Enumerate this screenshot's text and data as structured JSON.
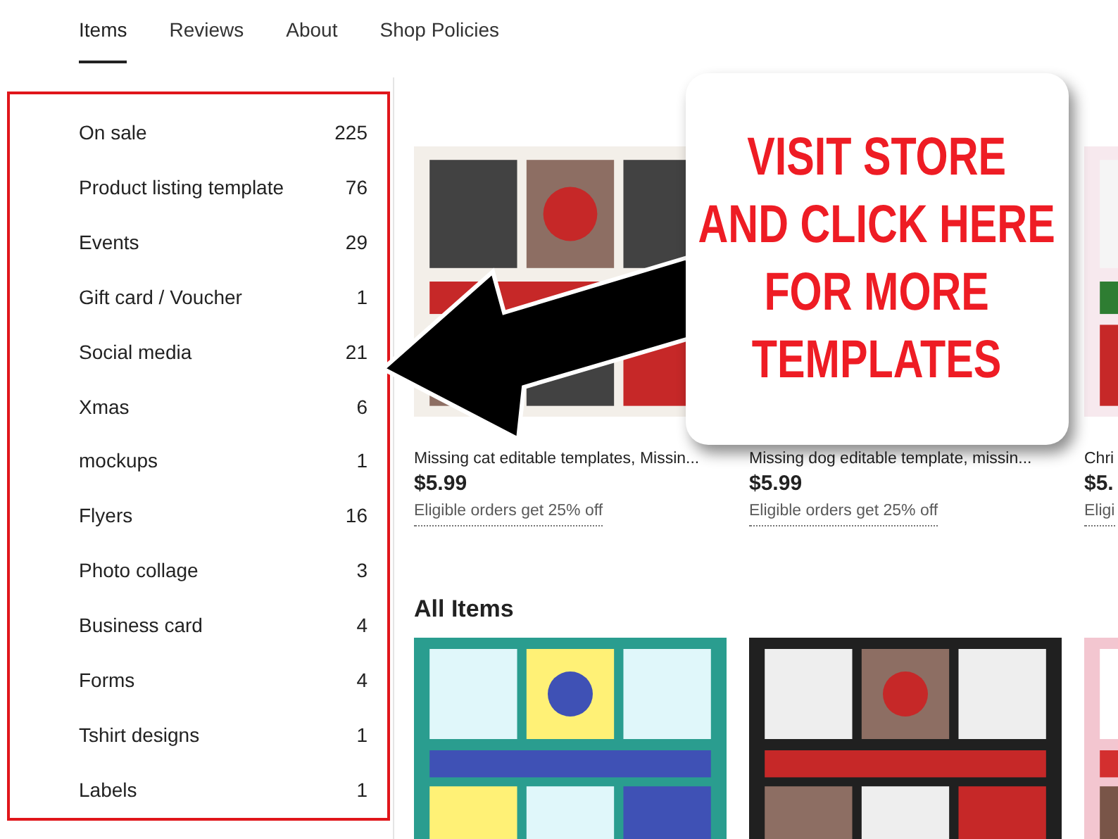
{
  "tabs": [
    {
      "label": "Items",
      "selected": true
    },
    {
      "label": "Reviews",
      "selected": false
    },
    {
      "label": "About",
      "selected": false
    },
    {
      "label": "Shop Policies",
      "selected": false
    }
  ],
  "sidebar": {
    "items": [
      {
        "label": "On sale",
        "count": "225"
      },
      {
        "label": "Product listing template",
        "count": "76"
      },
      {
        "label": "Events",
        "count": "29"
      },
      {
        "label": "Gift card / Voucher",
        "count": "1"
      },
      {
        "label": "Social media",
        "count": "21"
      },
      {
        "label": "Xmas",
        "count": "6"
      },
      {
        "label": "mockups",
        "count": "1"
      },
      {
        "label": "Flyers",
        "count": "16"
      },
      {
        "label": "Photo collage",
        "count": "3"
      },
      {
        "label": "Business card",
        "count": "4"
      },
      {
        "label": "Forms",
        "count": "4"
      },
      {
        "label": "Tshirt designs",
        "count": "1"
      },
      {
        "label": "Labels",
        "count": "1"
      }
    ]
  },
  "featured": [
    {
      "kind": "picture",
      "title": "Missing cat editable templates, Missin...",
      "price": "$5.99",
      "promo": "Eligible orders get 25% off"
    },
    {
      "title": "Missing dog editable template, missin...",
      "price": "$5.99",
      "promo": "Eligible orders get 25% off"
    },
    {
      "kind": "picture",
      "title": "Chri",
      "price": "$5.",
      "promo": "Eligi"
    }
  ],
  "all_items": {
    "heading": "All Items"
  },
  "callout": {
    "lines": [
      "VISIT STORE",
      "AND CLICK HERE",
      "FOR MORE",
      "TEMPLATES"
    ]
  }
}
